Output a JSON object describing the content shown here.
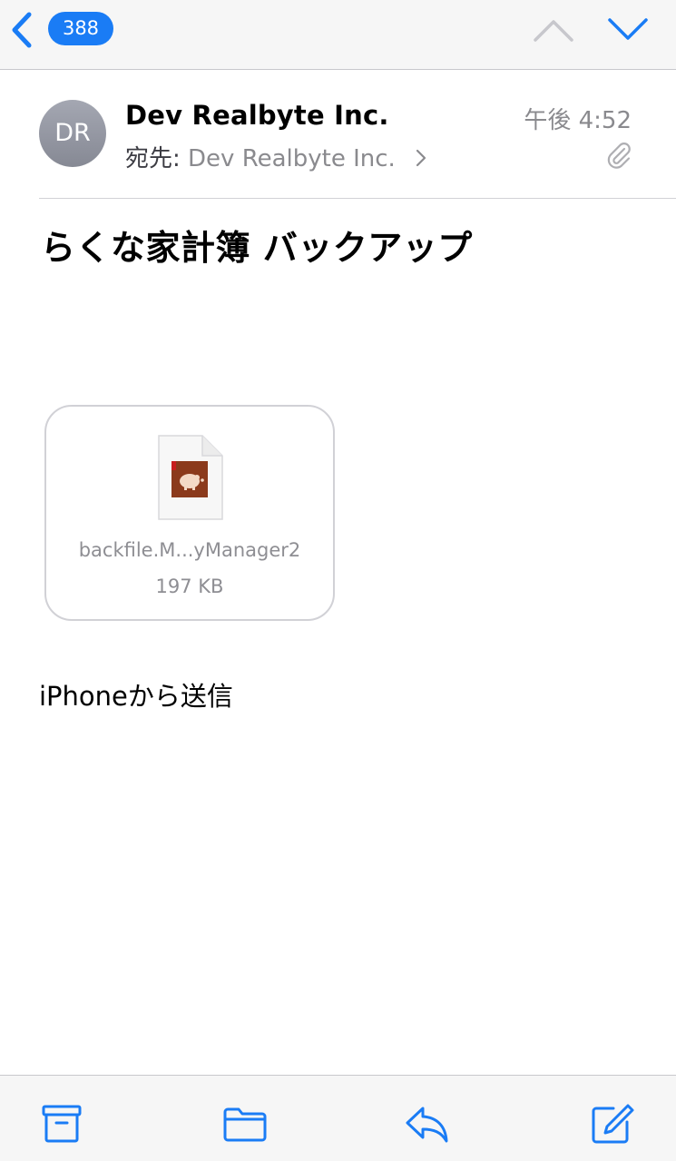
{
  "nav": {
    "unread_count": "388"
  },
  "message": {
    "avatar_initials": "DR",
    "sender": "Dev Realbyte Inc.",
    "recipient_label": "宛先:",
    "recipient": "Dev Realbyte Inc.",
    "time": "午後 4:52",
    "subject": "らくな家計簿 バックアップ",
    "attachment": {
      "name": "backfile.M...yManager2",
      "size": "197 KB"
    },
    "signature": "iPhoneから送信"
  },
  "colors": {
    "accent": "#1a7cf5",
    "secondary_text": "#8a8a8e",
    "app_icon_bg": "#8b3a1c"
  },
  "icons": {
    "back": "chevron-left-icon",
    "prev": "chevron-up-icon",
    "next": "chevron-down-icon",
    "attachment_flag": "paperclip-icon",
    "toolbar": [
      "archive-icon",
      "folder-icon",
      "reply-icon",
      "compose-icon"
    ]
  }
}
